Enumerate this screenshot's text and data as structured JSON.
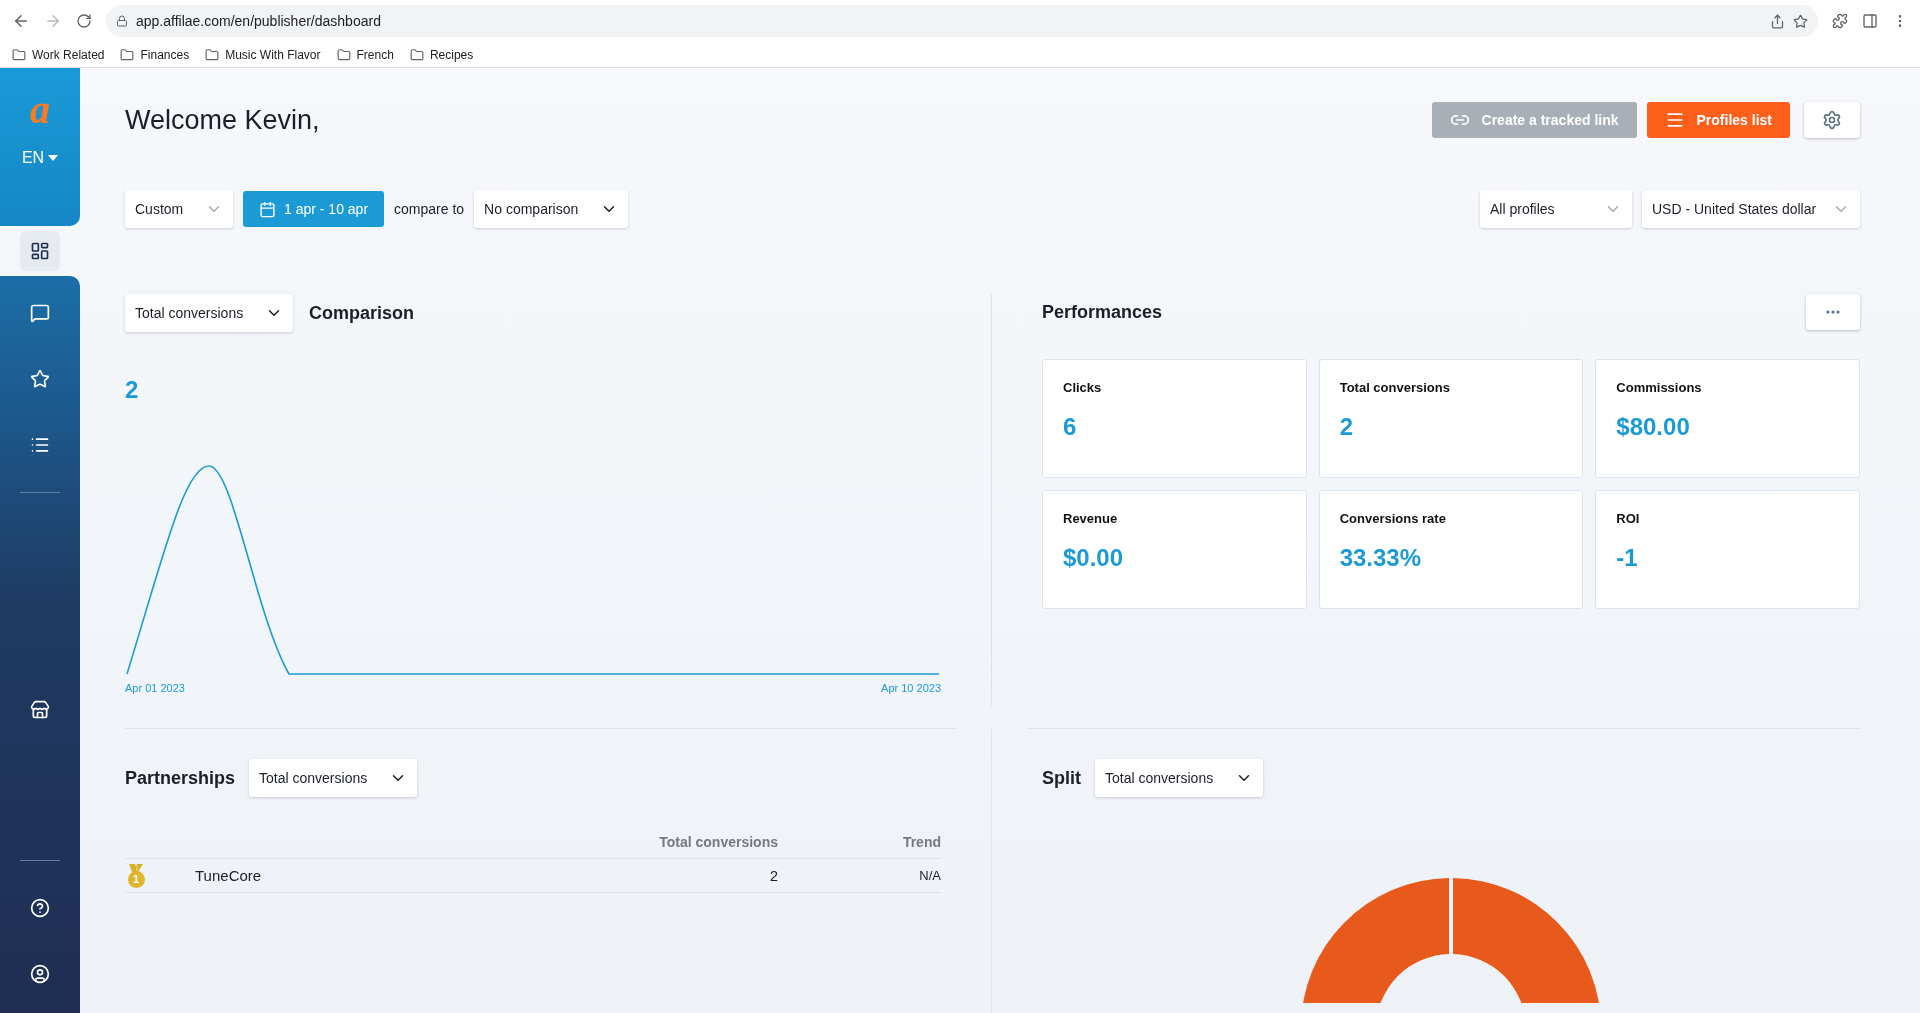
{
  "browser": {
    "url": "app.affilae.com/en/publisher/dashboard",
    "bookmarks": [
      "Work Related",
      "Finances",
      "Music With Flavor",
      "French",
      "Recipes"
    ]
  },
  "sidebar": {
    "logo": "a",
    "language": "EN",
    "items": [
      {
        "selected": true
      },
      {
        "selected": false
      },
      {
        "selected": false
      },
      {
        "selected": false
      },
      {
        "selected": false
      },
      {
        "selected": false
      },
      {
        "selected": false
      }
    ]
  },
  "header": {
    "title": "Welcome Kevin,",
    "buttons": [
      {
        "label": "Create a tracked link",
        "disabled": true
      },
      {
        "label": "Profiles list",
        "disabled": false
      }
    ]
  },
  "filters": {
    "period": "Custom",
    "date_range": "1 apr - 10 apr",
    "compare_label": "compare to",
    "comparison": "No comparison",
    "profiles": "All profiles",
    "currency": "USD - United States dollar"
  },
  "comparison": {
    "metric": "Total conversions",
    "title": "Comparison",
    "total": "2",
    "x_start": "Apr 01 2023",
    "x_end": "Apr 10 2023"
  },
  "performances": {
    "title": "Performances",
    "cards": [
      {
        "label": "Clicks",
        "value": "6"
      },
      {
        "label": "Total conversions",
        "value": "2"
      },
      {
        "label": "Commissions",
        "value": "$80.00"
      },
      {
        "label": "Revenue",
        "value": "$0.00"
      },
      {
        "label": "Conversions rate",
        "value": "33.33%"
      },
      {
        "label": "ROI",
        "value": "-1"
      }
    ]
  },
  "partnerships": {
    "title": "Partnerships",
    "metric": "Total conversions",
    "columns": [
      "Total conversions",
      "Trend"
    ],
    "rows": [
      {
        "rank": "1",
        "name": "TuneCore",
        "value": "2",
        "trend": "N/A"
      }
    ]
  },
  "split": {
    "title": "Split",
    "metric": "Total conversions"
  }
}
